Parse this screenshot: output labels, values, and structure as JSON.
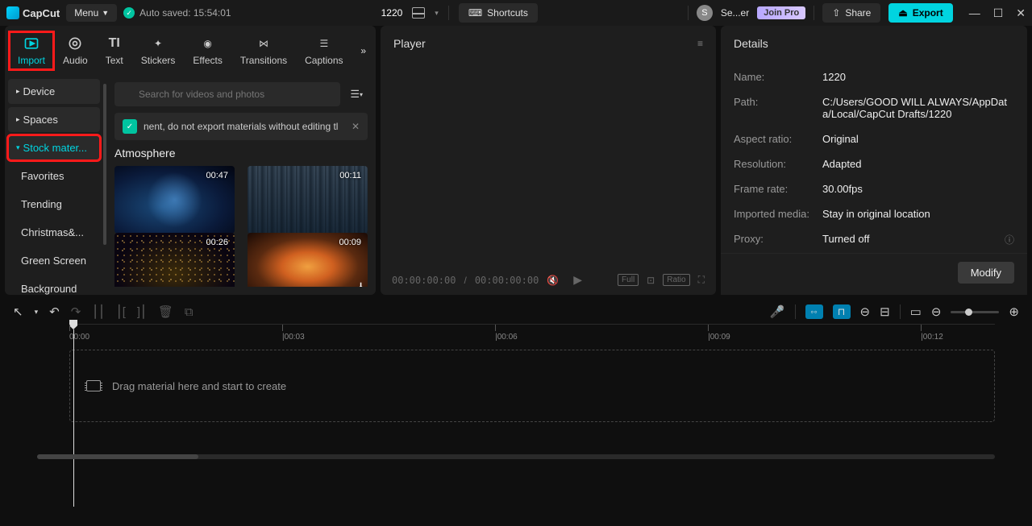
{
  "titlebar": {
    "app": "CapCut",
    "menu": "Menu",
    "autosave": "Auto saved: 15:54:01",
    "project": "1220",
    "shortcuts": "Shortcuts",
    "user": "Se...er",
    "joinpro": "Join Pro",
    "share": "Share",
    "export": "Export"
  },
  "toptabs": [
    "Import",
    "Audio",
    "Text",
    "Stickers",
    "Effects",
    "Transitions",
    "Captions"
  ],
  "sidebar": {
    "items": [
      "Device",
      "Spaces",
      "Stock mater...",
      "Favorites",
      "Trending",
      "Christmas&...",
      "Green Screen",
      "Background"
    ]
  },
  "content": {
    "search_placeholder": "Search for videos and photos",
    "notice": "nent, do not export materials without editing tl",
    "section": "Atmosphere",
    "thumbs": [
      {
        "duration": "00:47"
      },
      {
        "duration": "00:11"
      },
      {
        "duration": "00:26"
      },
      {
        "duration": "00:09"
      }
    ]
  },
  "player": {
    "title": "Player",
    "time_current": "00:00:00:00",
    "time_total": "00:00:00:00",
    "full": "Full",
    "ratio": "Ratio"
  },
  "details": {
    "title": "Details",
    "rows": [
      {
        "label": "Name:",
        "value": "1220"
      },
      {
        "label": "Path:",
        "value": "C:/Users/GOOD WILL ALWAYS/AppData/Local/CapCut Drafts/1220"
      },
      {
        "label": "Aspect ratio:",
        "value": "Original"
      },
      {
        "label": "Resolution:",
        "value": "Adapted"
      },
      {
        "label": "Frame rate:",
        "value": "30.00fps"
      },
      {
        "label": "Imported media:",
        "value": "Stay in original location"
      },
      {
        "label": "Proxy:",
        "value": "Turned off"
      }
    ],
    "modify": "Modify"
  },
  "timeline": {
    "ticks": [
      "00:00",
      "00:03",
      "00:06",
      "00:09",
      "00:12"
    ],
    "drop_hint": "Drag material here and start to create"
  }
}
